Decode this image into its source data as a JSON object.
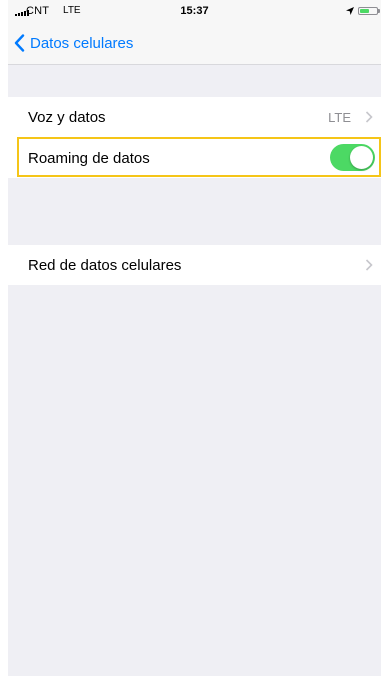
{
  "status_bar": {
    "carrier": "CNT",
    "network": "LTE",
    "time": "15:37",
    "battery_level": 0.55,
    "battery_color": "#4cd964"
  },
  "nav": {
    "back_label": "Datos celulares",
    "back_icon": "chevron-left-icon",
    "accent_color": "#007aff"
  },
  "settings": {
    "voice_data": {
      "label": "Voz y datos",
      "value": "LTE"
    },
    "roaming": {
      "label": "Roaming de datos",
      "enabled": true,
      "on_color": "#4cd964"
    },
    "cellular_network": {
      "label": "Red de datos celulares"
    }
  },
  "highlight_color": "#f5c518"
}
